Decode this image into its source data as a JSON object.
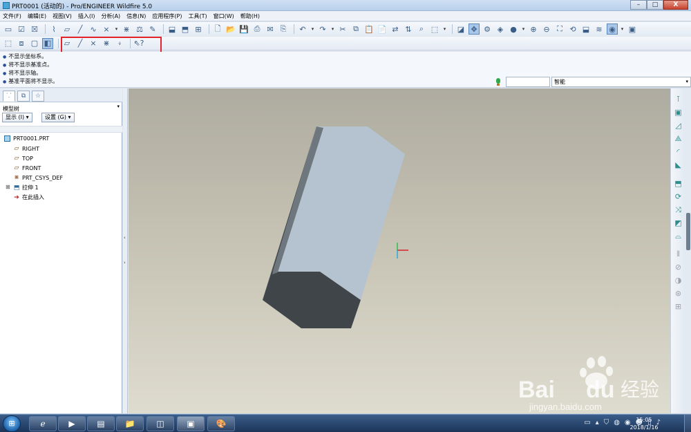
{
  "window": {
    "title": "PRT0001 (活动的) - Pro/ENGINEER Wildfire 5.0",
    "minimize": "–",
    "maximize": "□",
    "close": "X"
  },
  "menu": [
    "文件(F)",
    "编辑(E)",
    "视图(V)",
    "插入(I)",
    "分析(A)",
    "信息(N)",
    "应用程序(P)",
    "工具(T)",
    "窗口(W)",
    "帮助(H)"
  ],
  "messages": [
    "不显示坐标系。",
    "将不显示基准点。",
    "将不显示轴。",
    "基准平面将不显示。"
  ],
  "filter": {
    "selected": "智能"
  },
  "model_tree": {
    "header": "模型树",
    "show_button": "显示 (I) ▾",
    "settings_button": "设置 (G) ▾",
    "items": [
      {
        "label": "PRT0001.PRT",
        "icon": "part-icon"
      },
      {
        "label": "RIGHT",
        "icon": "datum-plane-icon"
      },
      {
        "label": "TOP",
        "icon": "datum-plane-icon"
      },
      {
        "label": "FRONT",
        "icon": "datum-plane-icon"
      },
      {
        "label": "PRT_CSYS_DEF",
        "icon": "csys-icon"
      },
      {
        "label": "拉伸 1",
        "icon": "extrude-icon"
      },
      {
        "label": "在此插入",
        "icon": "insert-here-icon"
      }
    ]
  },
  "taskbar": {
    "time": "15:05",
    "date": "2018/1/16"
  },
  "watermark": {
    "brand_latin": "Bai",
    "brand_du": "du",
    "brand_cn": "经验",
    "url": "jingyan.baidu.com"
  },
  "colors": {
    "highlight_box": "#e4222b",
    "model_top_face": "#b4c3cf",
    "model_side_face": "#4a5156",
    "model_end_face": "#3f4549",
    "csys_x": "#d9232b",
    "csys_y": "#2fbf4a",
    "csys_z": "#2aa8d8"
  }
}
